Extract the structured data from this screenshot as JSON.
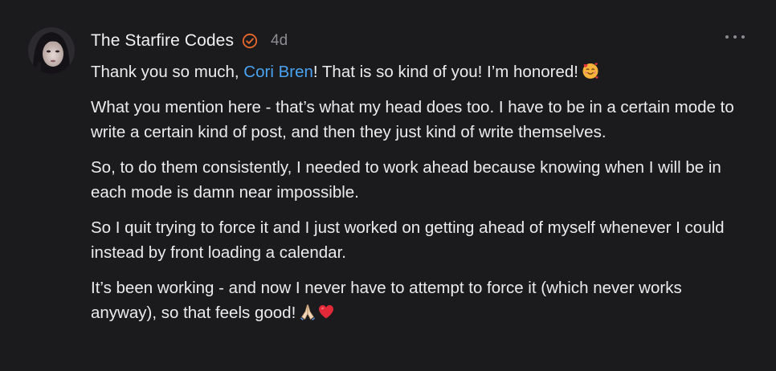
{
  "comment": {
    "author": "The Starfire Codes",
    "timestamp": "4d",
    "verified_icon": "verified-badge-icon",
    "more_icon": "more-options-icon",
    "accent_color": "#e8682c",
    "mention_color": "#4aa3f0",
    "paragraph1": {
      "before": "Thank you so much, ",
      "mention": "Cori Bren",
      "after": "! That is so kind of you! I’m honored!",
      "emoji": "smiling-face-with-hearts-emoji"
    },
    "paragraph2": "What you mention here - that’s what my head does too. I have to be in a certain mode to write a certain kind of post, and then they just kind of write themselves.",
    "paragraph3": "So, to do them consistently, I needed to work ahead because knowing when I will be in each mode is damn near impossible.",
    "paragraph4": "So I quit trying to force it and I just worked on getting ahead of myself whenever I could instead by front loading a calendar.",
    "paragraph5": {
      "text": "It’s been working - and now I never have to attempt to force it (which never works anyway), so that feels good!",
      "emojis": [
        "folded-hands-emoji",
        "red-heart-emoji"
      ]
    }
  }
}
